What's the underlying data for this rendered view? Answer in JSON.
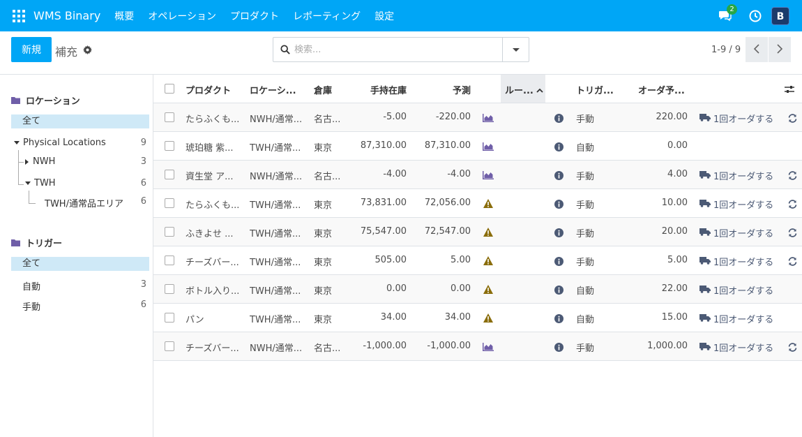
{
  "topbar": {
    "brand": "WMS Binary",
    "menu": [
      "概要",
      "オペレーション",
      "プロダクト",
      "レポーティング",
      "設定"
    ],
    "chat_badge": "2",
    "avatar_letter": "B"
  },
  "control": {
    "new_label": "新規",
    "breadcrumb": "補充",
    "search_placeholder": "検索...",
    "pager": "1-9 / 9"
  },
  "sidebar": {
    "location_title": "ロケーション",
    "location_all": "全て",
    "locations": [
      {
        "label": "Physical Locations",
        "count": "9"
      },
      {
        "label": "NWH",
        "count": "3"
      },
      {
        "label": "TWH",
        "count": "6"
      },
      {
        "label": "TWH/通常品エリア",
        "count": "6"
      }
    ],
    "trigger_title": "トリガー",
    "trigger_all": "全て",
    "triggers": [
      {
        "label": "自動",
        "count": "3"
      },
      {
        "label": "手動",
        "count": "6"
      }
    ]
  },
  "table": {
    "headers": {
      "product": "プロダクト",
      "location": "ロケーシ...",
      "warehouse": "倉庫",
      "on_hand": "手持在庫",
      "forecast": "予測",
      "route": "ルー...",
      "trigger": "トリガ...",
      "to_order": "オーダ予..."
    },
    "order_label": "1回オーダする",
    "rows": [
      {
        "product": "たらふくも...",
        "location": "NWH/通常...",
        "warehouse": "名古...",
        "on_hand": "-5.00",
        "forecast": "-220.00",
        "status": "chart",
        "trigger": "手動",
        "to_order": "220.00",
        "order": true,
        "refresh": true
      },
      {
        "product": "琥珀糖 紫...",
        "location": "TWH/通常...",
        "warehouse": "東京",
        "on_hand": "87,310.00",
        "forecast": "87,310.00",
        "status": "chart",
        "trigger": "自動",
        "to_order": "0.00",
        "order": false,
        "refresh": false
      },
      {
        "product": "資生堂 ア...",
        "location": "NWH/通常...",
        "warehouse": "名古...",
        "on_hand": "-4.00",
        "forecast": "-4.00",
        "status": "chart",
        "trigger": "手動",
        "to_order": "4.00",
        "order": true,
        "refresh": true
      },
      {
        "product": "たらふくも...",
        "location": "TWH/通常...",
        "warehouse": "東京",
        "on_hand": "73,831.00",
        "forecast": "72,056.00",
        "status": "warning",
        "trigger": "手動",
        "to_order": "10.00",
        "order": true,
        "refresh": true
      },
      {
        "product": "ふきよせ ...",
        "location": "TWH/通常...",
        "warehouse": "東京",
        "on_hand": "75,547.00",
        "forecast": "72,547.00",
        "status": "warning",
        "trigger": "手動",
        "to_order": "20.00",
        "order": true,
        "refresh": true
      },
      {
        "product": "チーズバー...",
        "location": "TWH/通常...",
        "warehouse": "東京",
        "on_hand": "505.00",
        "forecast": "5.00",
        "status": "warning",
        "trigger": "手動",
        "to_order": "5.00",
        "order": true,
        "refresh": true
      },
      {
        "product": "ボトル入り...",
        "location": "TWH/通常...",
        "warehouse": "東京",
        "on_hand": "0.00",
        "forecast": "0.00",
        "status": "warning",
        "trigger": "自動",
        "to_order": "22.00",
        "order": true,
        "refresh": false
      },
      {
        "product": "パン",
        "location": "TWH/通常...",
        "warehouse": "東京",
        "on_hand": "34.00",
        "forecast": "34.00",
        "status": "warning",
        "trigger": "自動",
        "to_order": "15.00",
        "order": true,
        "refresh": false
      },
      {
        "product": "チーズバー...",
        "location": "NWH/通常...",
        "warehouse": "名古...",
        "on_hand": "-1,000.00",
        "forecast": "-1,000.00",
        "status": "chart",
        "trigger": "手動",
        "to_order": "1,000.00",
        "order": true,
        "refresh": true
      }
    ]
  },
  "colors": {
    "brand": "#00A6F6",
    "order_text": "#4c5a75",
    "warning": "#8a6d0b",
    "chart_icon": "#6f5ea8"
  }
}
